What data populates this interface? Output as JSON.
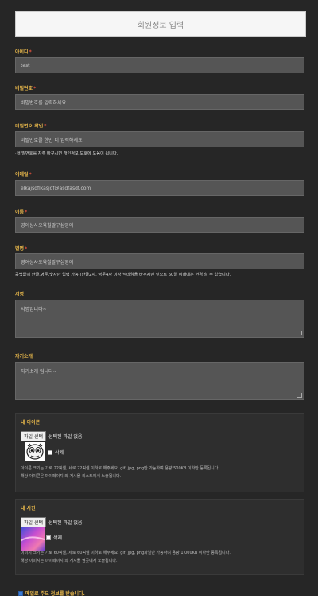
{
  "header": {
    "title": "회원정보 입력"
  },
  "fields": {
    "id": {
      "label": "아이디",
      "value": "test"
    },
    "password": {
      "label": "비밀번호",
      "placeholder": "비밀번호를 입력하세요."
    },
    "password_confirm": {
      "label": "비밀번호 확인",
      "placeholder": "비밀번호를 한번 더 입력하세요.",
      "help": "· 비밀번호를 자주 바꾸시면 개인정보 보호에 도움이 됩니다."
    },
    "email": {
      "label": "이메일",
      "value": "elkajsdflkasjdf@asdfasdf.com"
    },
    "name": {
      "label": "이름",
      "value": "영어상사오육칠팔구십영어"
    },
    "nickname": {
      "label": "별명",
      "value": "영어상사오육칠팔구십영어",
      "help": "공백없이 한글,영문,숫자만 입력 가능 (한글2자, 영문4자 이상)닉네임을 바꾸시면 앞으로 60일 이내에는 변경 할 수 없습니다."
    },
    "signature": {
      "label": "서명",
      "value": "서명입니다~"
    },
    "intro": {
      "label": "자기소개",
      "value": "자기소개 입니다~"
    }
  },
  "icon_box": {
    "title": "내 아이콘",
    "file_button": "파일 선택",
    "file_status": "선택된 파일 없음",
    "delete_label": "삭제",
    "note1": "아이콘 크기는 가로 22픽셀, 세로 22픽셀 이하로 해주세요. gif, jpg, png만 가능하며 용량 500KB 이하만 등록됩니다.",
    "note2": "해당 아이콘은 마이페이지 와 게시물 리스트에서 노출됩니다."
  },
  "photo_box": {
    "title": "내 사진",
    "file_button": "파일 선택",
    "file_status": "선택된 파일 없음",
    "delete_label": "삭제",
    "note1": "이미지 크기는 가로 60픽셀, 세로 60픽셀 이하로 해주세요. gif, jpg, png파일만 가능하며 용량 1,000KB 이하만 등록됩니다.",
    "note2": "해당 이미지는 마이페이지 와 게시물 옆곳에서 노출됩니다."
  },
  "agree": {
    "label": "메일로 주요 정보를 받습니다."
  },
  "colors": {
    "accent": "#e8b84b",
    "required": "#e5533d",
    "background": "#262626"
  }
}
